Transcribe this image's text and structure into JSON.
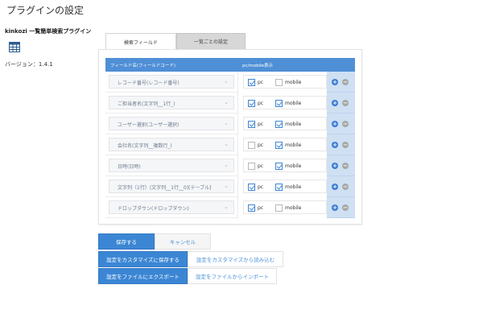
{
  "page": {
    "title": "プラグインの設定"
  },
  "plugin": {
    "name": "kinkozi 一覧簡単検索プラグイン",
    "icon": "table-grid-icon",
    "version": "バージョン：1.4.1"
  },
  "tabs": [
    {
      "label": "検索フィールド",
      "active": true
    },
    {
      "label": "一覧ごとの設定",
      "active": false
    }
  ],
  "table": {
    "headers": {
      "field": "フィールド名(フィールドコード)",
      "display": "pc/mobile表示"
    },
    "pc_label": "pc",
    "mobile_label": "mobile",
    "rows": [
      {
        "field": "レコード番号(レコード番号)",
        "pc": true,
        "mobile": false
      },
      {
        "field": "ご担当者名(文字列__1行_)",
        "pc": true,
        "mobile": true
      },
      {
        "field": "ユーザー選択(ユーザー選択)",
        "pc": true,
        "mobile": true
      },
      {
        "field": "会社名(文字列__複数行_)",
        "pc": false,
        "mobile": true
      },
      {
        "field": "日時(日時)",
        "pc": false,
        "mobile": true
      },
      {
        "field": "文字列（1行）(文字列__1行__0)[テーブル]",
        "pc": true,
        "mobile": true
      },
      {
        "field": "ドロップダウン(ドロップダウン)",
        "pc": true,
        "mobile": false
      }
    ]
  },
  "buttons": {
    "save": "保存する",
    "cancel": "キャンセル",
    "save_customize": "設定をカスタマイズに保存する",
    "load_customize": "設定をカスタマイズから読み込む",
    "export_file": "設定をファイルにエクスポート",
    "import_file": "設定をファイルからインポート"
  },
  "colors": {
    "accent": "#3b86d4",
    "header": "#4f8fd6",
    "action_cell": "#cfe0f3",
    "remove": "#a7a7a7"
  }
}
